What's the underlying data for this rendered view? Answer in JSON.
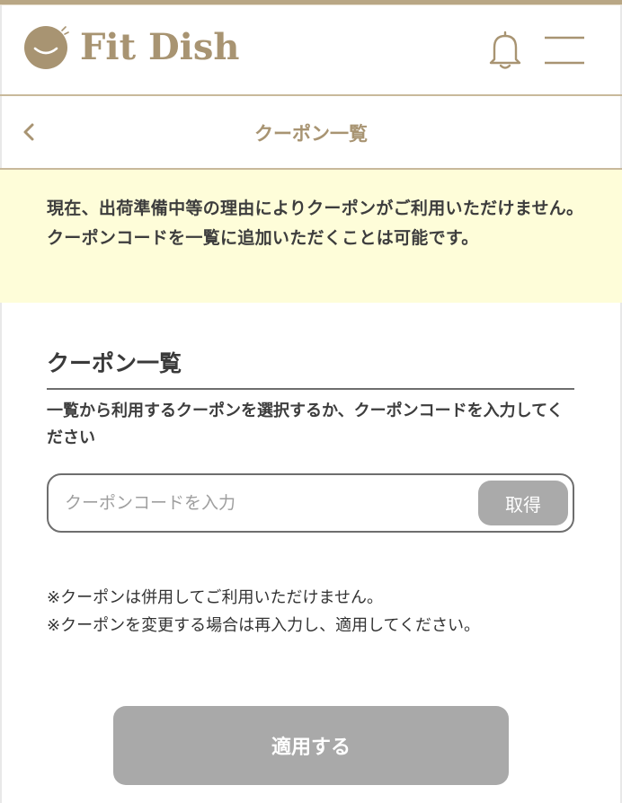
{
  "header": {
    "logo_text": "Fit Dish",
    "bell_icon": "bell-icon",
    "menu_icon": "hamburger-menu-icon"
  },
  "subheader": {
    "back_icon": "chevron-left-icon",
    "title": "クーポン一覧"
  },
  "notice": {
    "text": "現在、出荷準備中等の理由によりクーポンがご利用いただけません。クーポンコードを一覧に追加いただくことは可能です。"
  },
  "coupon_section": {
    "title": "クーポン一覧",
    "instruction": "一覧から利用するクーポンを選択するか、クーポンコードを入力してください",
    "input_placeholder": "クーポンコードを入力",
    "input_value": "",
    "get_button_label": "取得"
  },
  "notes": {
    "line1": "※クーポンは併用してご利用いただけません。",
    "line2": "※クーポンを変更する場合は再入力し、適用してください。"
  },
  "apply_button_label": "適用する",
  "colors": {
    "brand": "#a89472",
    "brand_line": "#c8b99b",
    "notice_bg": "#fefdd9",
    "disabled_button": "#aaaaaa"
  }
}
